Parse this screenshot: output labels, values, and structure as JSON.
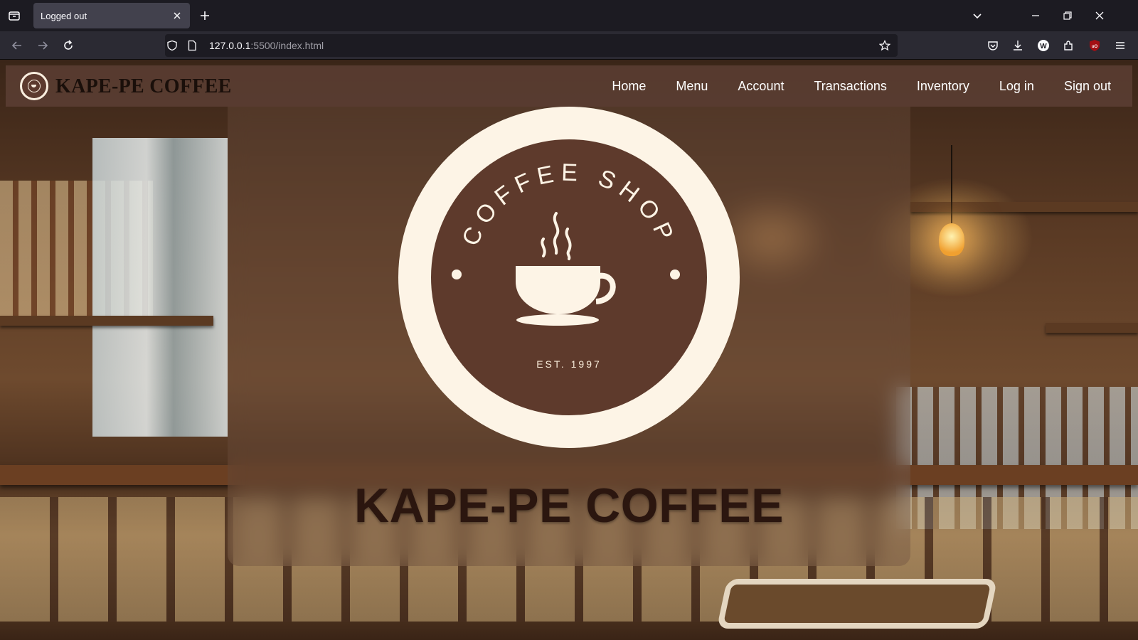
{
  "browser": {
    "tab_title": "Logged out",
    "url_host": "127.0.0.1",
    "url_path": ":5500/index.html"
  },
  "site": {
    "brand_name": "KAPE-PE COFFEE",
    "nav": [
      "Home",
      "Menu",
      "Account",
      "Transactions",
      "Inventory",
      "Log in",
      "Sign out"
    ]
  },
  "hero": {
    "logo_arc_text": "COFFEE SHOP",
    "logo_est": "EST. 1997",
    "title": "KAPE-PE COFFEE"
  },
  "colors": {
    "header_bg": "#5c3e34",
    "logo_cream": "#fdf4e6",
    "logo_brown": "#5e3a2c",
    "title_text": "#2b160f"
  }
}
